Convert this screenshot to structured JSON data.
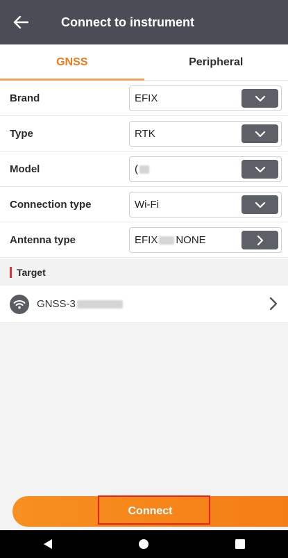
{
  "header": {
    "title": "Connect to instrument",
    "back_icon": "arrow-left-icon"
  },
  "tabs": [
    {
      "label": "GNSS",
      "active": true
    },
    {
      "label": "Peripheral",
      "active": false
    }
  ],
  "form": {
    "brand": {
      "label": "Brand",
      "value": "EFIX"
    },
    "type": {
      "label": "Type",
      "value": "RTK"
    },
    "model": {
      "label": "Model",
      "value": "("
    },
    "connection_type": {
      "label": "Connection type",
      "value": "Wi-Fi"
    },
    "antenna_type": {
      "label": "Antenna type",
      "value_prefix": "EFIX",
      "value_suffix": "NONE"
    }
  },
  "target": {
    "section_title": "Target",
    "device": {
      "name_prefix": "GNSS-3",
      "icon": "wifi-icon"
    }
  },
  "connect": {
    "label": "Connect"
  },
  "colors": {
    "header_bg": "#4a4d55",
    "accent": "#f07a1a",
    "button_gradient_start": "#f6901f",
    "button_gradient_end": "#f57d16",
    "dropdown_bg": "#5e6068",
    "section_marker": "#e0323c"
  }
}
